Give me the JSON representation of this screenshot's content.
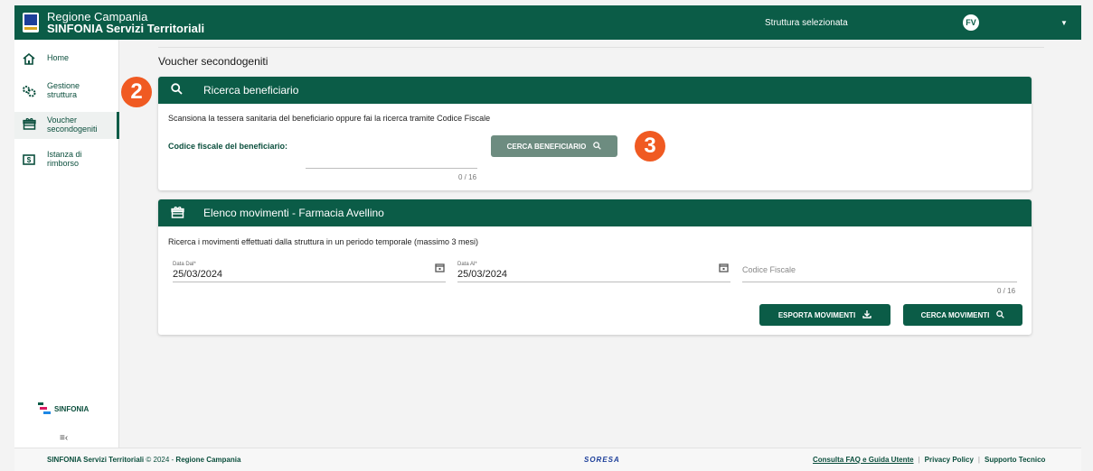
{
  "header": {
    "region": "Regione Campania",
    "app": "SINFONIA Servizi Territoriali",
    "struttura": "Struttura selezionata",
    "avatar": "FV",
    "caret": "▼"
  },
  "sidebar": {
    "items": [
      {
        "label": "Home",
        "icon": "home-icon",
        "glyph": "⌂"
      },
      {
        "label": "Gestione struttura",
        "icon": "gears-icon",
        "glyph": "⚙"
      },
      {
        "label": "Voucher secondogeniti",
        "icon": "gift-box-icon",
        "glyph": "🎁"
      },
      {
        "label": "Istanza di rimborso",
        "icon": "money-icon",
        "glyph": "$"
      }
    ],
    "logo_text": "SINFONIA",
    "collapse": "≡‹"
  },
  "main": {
    "title": "Voucher secondogeniti",
    "search_card": {
      "title": "Ricerca beneficiario",
      "description": "Scansiona la tessera sanitaria del beneficiario oppure fai la ricerca tramite Codice Fiscale",
      "field_label": "Codice fiscale del beneficiario:",
      "counter": "0 / 16",
      "button": "CERCA BENEFICIARIO"
    },
    "movements_card": {
      "title": "Elenco movimenti - Farmacia Avellino",
      "description": "Ricerca i movimenti effettuati dalla struttura in un periodo temporale (massimo 3 mesi)",
      "date_from_label": "Data Dal*",
      "date_from": "25/03/2024",
      "date_to_label": "Data Al*",
      "date_to": "25/03/2024",
      "cf_placeholder": "Codice Fiscale",
      "counter": "0 / 16",
      "export_button": "ESPORTA MOVIMENTI",
      "search_button": "CERCA MOVIMENTI"
    }
  },
  "badges": [
    "2",
    "3"
  ],
  "footer": {
    "app": "SINFONIA Servizi Territoriali",
    "copyright": "© 2024 -",
    "region": "Regione Campania",
    "soresa": "SORESA",
    "faq": "Consulta FAQ e Guida Utente",
    "privacy": "Privacy Policy",
    "support": "Supporto Tecnico"
  },
  "colors": {
    "primary": "#0b5c47",
    "badge": "#f05a22",
    "button_disabled": "#6d8c80"
  }
}
